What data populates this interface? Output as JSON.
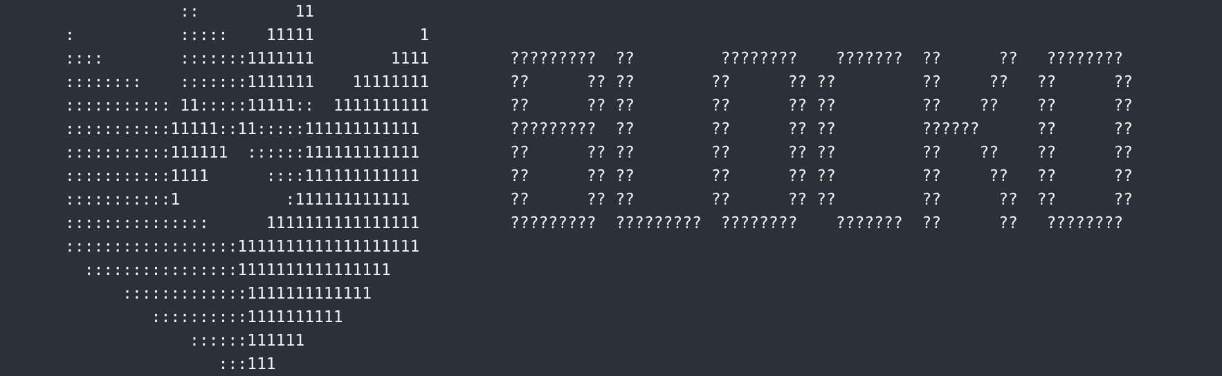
{
  "terminal": {
    "background_color": "#2b3138",
    "text_color": "#f3f5f7",
    "heart_art": {
      "lines": [
        "            ::          11",
        ":           :::::    11111           1",
        "::::        :::::::1111111        1111",
        "::::::::    :::::::1111111    11111111",
        "::::::::::: 11:::::11111::  1111111111",
        ":::::::::::11111::11:::::111111111111",
        ":::::::::::111111  ::::::111111111111",
        ":::::::::::1111      ::::111111111111",
        ":::::::::::1           :111111111111",
        ":::::::::::::::      1111111111111111",
        "::::::::::::::::::1111111111111111111",
        "  ::::::::::::::::1111111111111111",
        "      :::::::::::::1111111111111",
        "         ::::::::::1111111111",
        "             ::::::111111",
        "                :::111"
      ]
    },
    "word_art": {
      "lines": [
        "?????????  ??         ????????    ???????  ??      ??   ????????",
        "??      ?? ??        ??      ?? ??         ??     ??   ??      ??",
        "??      ?? ??        ??      ?? ??         ??    ??    ??      ??",
        "?????????  ??        ??      ?? ??         ??????      ??      ??",
        "??      ?? ??        ??      ?? ??         ??    ??    ??      ??",
        "??      ?? ??        ??      ?? ??         ??     ??   ??      ??",
        "??      ?? ??        ??      ?? ??         ??      ??  ??      ??",
        "?????????  ?????????  ????????    ???????  ??      ??   ????????"
      ]
    }
  }
}
